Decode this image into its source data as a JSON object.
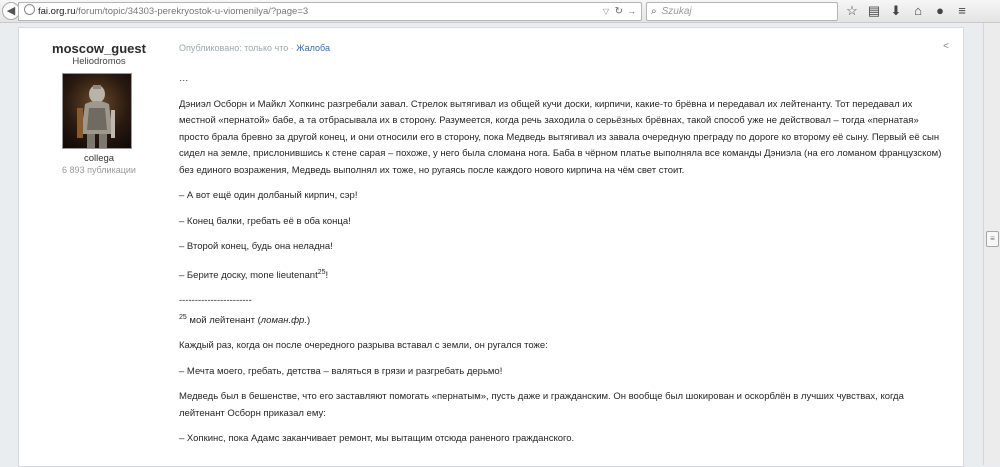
{
  "browser": {
    "url_host": "fai.org.ru",
    "url_path": "/forum/topic/34303-perekryostok-u-viomenilya/?page=3",
    "search_placeholder": "Szukaj",
    "icons": [
      "back-icon",
      "globe-icon",
      "reload-icon",
      "search-icon",
      "star-icon",
      "reading-list-icon",
      "download-icon",
      "home-icon",
      "chat-icon",
      "menu-icon"
    ]
  },
  "post": {
    "author": "moscow_guest",
    "author_title": "Heliodromos",
    "rank": "collega",
    "post_count": "6 893 публикации",
    "meta_prefix": "Опубликовано: только что · ",
    "report_label": "Жалоба",
    "paragraphs": [
      "…",
      "Дэниэл Осборн и Майкл Хопкинс разгребали завал. Стрелок вытягивал из общей кучи доски, кирпичи, какие-то брёвна и передавал их лейтенанту. Тот передавал их местной «пернатой» бабе, а та отбрасывала их в сторону. Разумеется, когда речь заходила о серьёзных брёвнах, такой способ уже не действовал – тогда «пернатая» просто брала бревно за другой конец, и они относили его в сторону, пока Медведь вытягивал из завала очередную преграду по дороге ко второму её сыну. Первый её сын сидел на земле, прислонившись к стене сарая – похоже, у него была сломана нога. Баба в чёрном платье выполняла все команды Дэниэла (на его ломаном французском) без единого возражения, Медведь выполнял их тоже, но ругаясь после каждого нового кирпича на чём свет стоит.",
      "– А вот ещё один долбаный кирпич, сэр!",
      "– Конец балки, гребать её в оба конца!",
      "– Второй конец, будь она неладна!"
    ],
    "quote_main": "– Берите доску, mone lieutenant",
    "quote_sup": "25",
    "quote_end": "!",
    "footnote_rule": "-----------------------",
    "footnote_num": "25",
    "footnote_text": " мой лейтенант (",
    "footnote_italic": "ломан.фр.",
    "footnote_close": ")",
    "paragraphs_after": [
      "Каждый раз, когда он после очередного разрыва вставал с земли, он ругался тоже:",
      "– Мечта моего, гребать, детства – валяться в грязи и разгребать дерьмо!",
      "Медведь был в бешенстве, что его заставляют помогать «пернатым», пусть даже и гражданским. Он вообще был шокирован и оскорблён в лучших чувствах, когда лейтенант Осборн приказал ему:",
      "– Хопкинс, пока Адамс заканчивает ремонт, мы вытащим отсюда раненого гражданского."
    ]
  },
  "colors": {
    "link": "#356eaa",
    "muted": "#999999",
    "background": "#e9edf0"
  }
}
